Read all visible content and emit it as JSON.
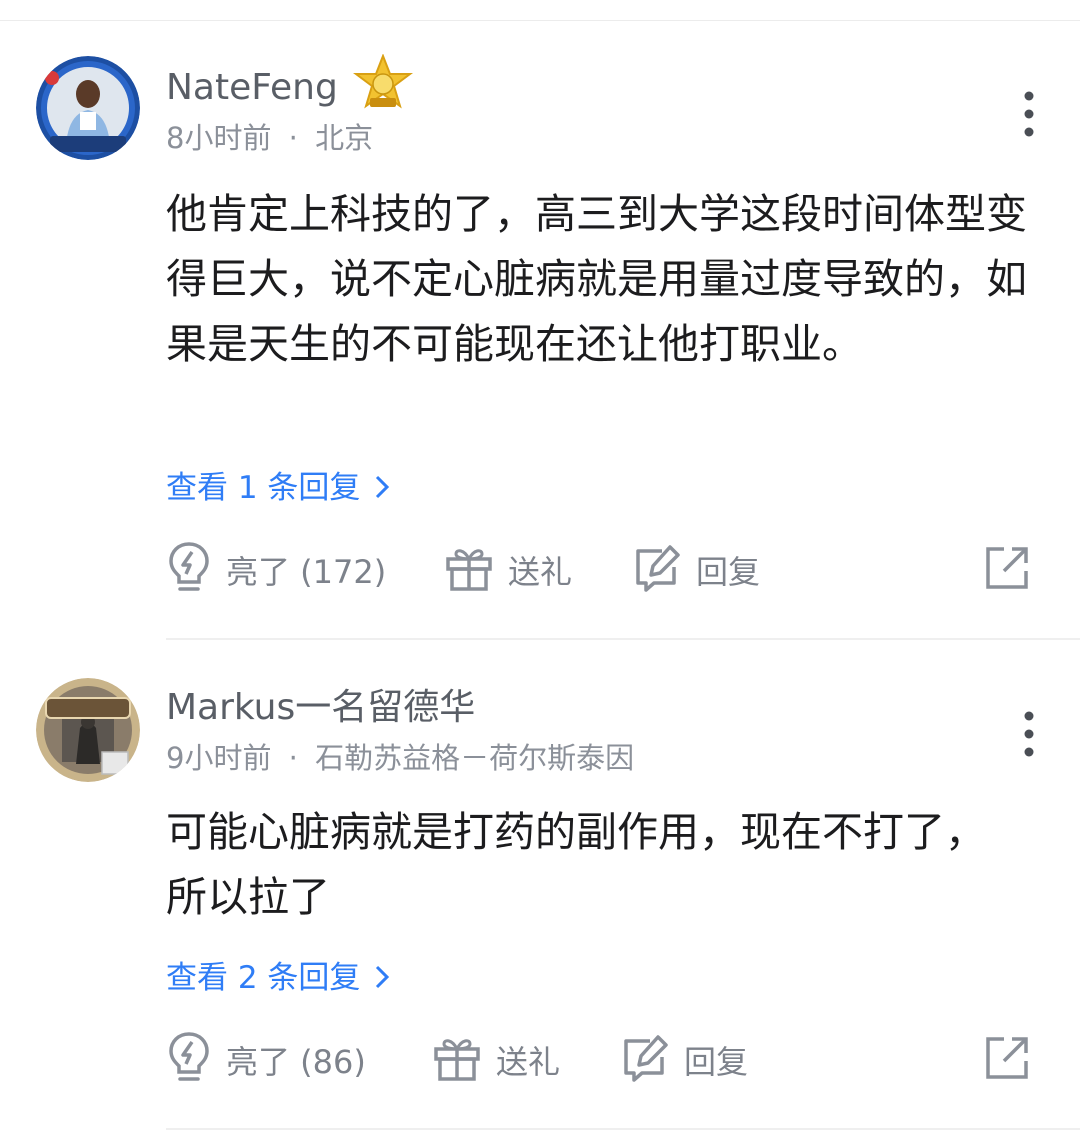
{
  "comments": [
    {
      "username": "NateFeng",
      "avatar_icon": "chelsea-player-avatar",
      "badge_icon": "gold-star-badge-icon",
      "time": "8小时前",
      "separator": "·",
      "location": "北京",
      "text": "他肯定上科技的了，高三到大学这段时间体型变得巨大，说不定心脏病就是用量过度导致的，如果是天生的不可能现在还让他打职业。",
      "view_replies": "查看 1 条回复",
      "actions": {
        "like": "亮了 (172)",
        "gift": "送礼",
        "reply": "回复"
      }
    },
    {
      "username": "Markus一名留德华",
      "avatar_icon": "tiger-flutter-avatar",
      "time": "9小时前",
      "separator": "·",
      "location": "石勒苏益格－荷尔斯泰因",
      "text": "可能心脏病就是打药的副作用，现在不打了，所以拉了",
      "view_replies": "查看 2 条回复",
      "actions": {
        "like": "亮了 (86)",
        "gift": "送礼",
        "reply": "回复"
      }
    }
  ],
  "colors": {
    "link": "#2f7df6",
    "meta": "#8b9099",
    "icon": "#8b9099",
    "username": "#595e66"
  }
}
